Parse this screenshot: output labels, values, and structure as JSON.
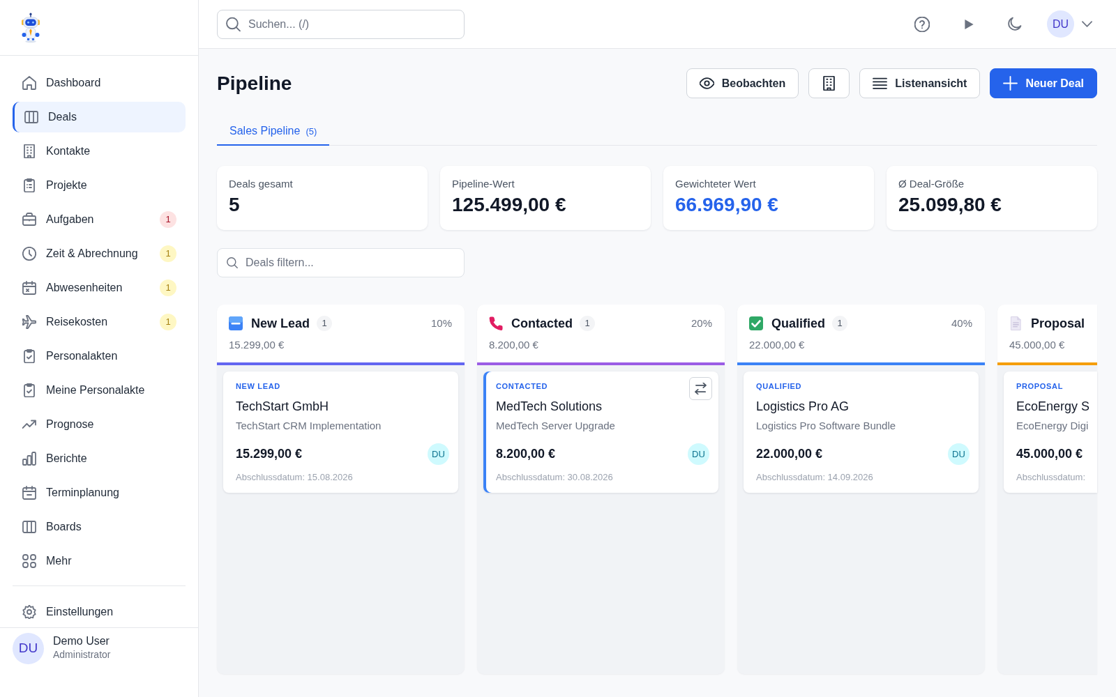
{
  "sidebar": {
    "items": [
      {
        "label": "Dashboard",
        "selected": false
      },
      {
        "label": "Deals",
        "selected": true
      },
      {
        "label": "Kontakte",
        "selected": false
      },
      {
        "label": "Projekte",
        "selected": false
      },
      {
        "label": "Aufgaben",
        "selected": false,
        "badge": {
          "text": "1",
          "color": "#fde2e2"
        }
      },
      {
        "label": "Zeit & Abrechnung",
        "selected": false,
        "badge": {
          "text": "1",
          "color": "#fef7c3"
        }
      },
      {
        "label": "Abwesenheiten",
        "selected": false,
        "badge": {
          "text": "1",
          "color": "#fef7c3"
        }
      },
      {
        "label": "Reisekosten",
        "selected": false,
        "badge": {
          "text": "1",
          "color": "#fef7c3"
        }
      },
      {
        "label": "Personalakten",
        "selected": false
      },
      {
        "label": "Meine Personalakte",
        "selected": false
      },
      {
        "label": "Prognose",
        "selected": false
      },
      {
        "label": "Berichte",
        "selected": false
      },
      {
        "label": "Terminplanung",
        "selected": false
      },
      {
        "label": "Boards",
        "selected": false
      },
      {
        "label": "Mehr",
        "selected": false
      }
    ],
    "bottom_items": [
      {
        "label": "Einstellungen",
        "selected": false
      }
    ],
    "user": {
      "initials": "DU",
      "name": "Demo User",
      "role": "Administrator"
    }
  },
  "header": {
    "search": {
      "placeholder": "Suchen... (/)"
    },
    "avatar": {
      "initials": "DU"
    }
  },
  "page": {
    "title": "Pipeline",
    "actions": [
      {
        "label": "Beobachten",
        "primary": false
      },
      {
        "primary": false
      },
      {
        "label": "Listenansicht",
        "primary": false
      },
      {
        "label": "Neuer Deal",
        "primary": true
      }
    ]
  },
  "tabs": [
    {
      "label": "Sales Pipeline",
      "count": "(5)",
      "selected": true
    }
  ],
  "stats": [
    {
      "label": "Deals gesamt",
      "value": "5",
      "highlighted": false
    },
    {
      "label": "Pipeline-Wert",
      "value": "125.499,00 €",
      "highlighted": false
    },
    {
      "label": "Gewichteter Wert",
      "value": "66.969,90 €",
      "highlighted": true
    },
    {
      "label": "Ø Deal-Größe",
      "value": "25.099,80 €",
      "highlighted": false
    }
  ],
  "filter": {
    "placeholder": "Deals filtern..."
  },
  "board": {
    "columns": [
      {
        "title": "New Lead",
        "count": "1",
        "percent": "10%",
        "total": "15.299,00 €",
        "color": "#6366f1",
        "deals": [
          {
            "stage": "NEW LEAD",
            "company": "TechStart GmbH",
            "title": "TechStart CRM Implementation",
            "amount": "15.299,00 €",
            "owner": "DU",
            "close_date": "Abschlussdatum: 15.08.2026",
            "selected": false
          }
        ]
      },
      {
        "title": "Contacted",
        "count": "1",
        "percent": "20%",
        "total": "8.200,00 €",
        "color": "#9b5de5",
        "deals": [
          {
            "stage": "CONTACTED",
            "company": "MedTech Solutions",
            "title": "MedTech Server Upgrade",
            "amount": "8.200,00 €",
            "owner": "DU",
            "close_date": "Abschlussdatum: 30.08.2026",
            "selected": true
          }
        ]
      },
      {
        "title": "Qualified",
        "count": "1",
        "percent": "40%",
        "total": "22.000,00 €",
        "color": "#3b82f6",
        "deals": [
          {
            "stage": "QUALIFIED",
            "company": "Logistics Pro AG",
            "title": "Logistics Pro Software Bundle",
            "amount": "22.000,00 €",
            "owner": "DU",
            "close_date": "Abschlussdatum: 14.09.2026",
            "selected": false
          }
        ]
      },
      {
        "title": "Proposal",
        "total": "45.000,00 €",
        "color": "#f59e0b",
        "deals": [
          {
            "stage": "PROPOSAL",
            "company": "EcoEnergy S",
            "title": "EcoEnergy Digi",
            "amount": "45.000,00 €",
            "close_date": "Abschlussdatum:",
            "selected": false
          }
        ]
      }
    ]
  }
}
